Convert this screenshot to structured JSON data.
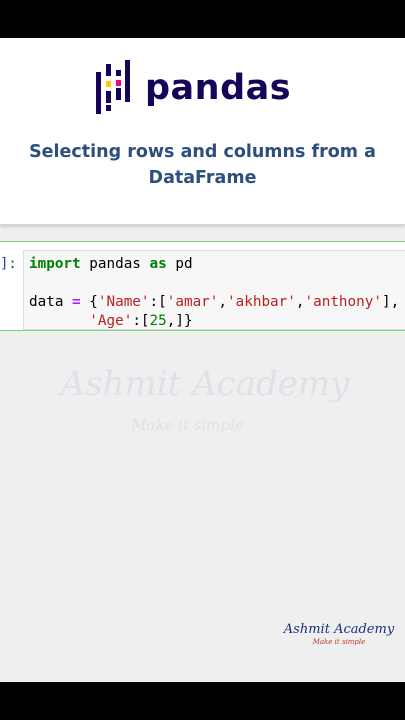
{
  "header": {
    "logo_text": "pandas",
    "subtitle": "Selecting rows and columns from a DataFrame"
  },
  "cell": {
    "prompt": "]:",
    "code": {
      "l1_kw1": "import",
      "l1_mod": " pandas ",
      "l1_kw2": "as",
      "l1_alias": " pd",
      "l3_var": "data ",
      "l3_op": "=",
      "l3_open": " {",
      "l3_key": "'Name'",
      "l3_colon": ":[",
      "l3_s1": "'amar'",
      "l3_c1": ",",
      "l3_s2": "'akhbar'",
      "l3_c2": ",",
      "l3_s3": "'anthony'",
      "l3_close": "],",
      "l4_indent": "       ",
      "l4_key": "'Age'",
      "l4_colon": ":[",
      "l4_num": "25",
      "l4_close": ",]}"
    }
  },
  "watermark": {
    "name": "Ashmit Academy",
    "tagline": "Make it simple"
  },
  "brand": {
    "name": "Ashmit Academy",
    "tagline": "Make it simple"
  },
  "colors": {
    "pandas_navy": "#150458",
    "pandas_yellow": "#ffca00",
    "pandas_pink": "#e70488",
    "subtitle": "#2d4f7e",
    "cell_border": "#7cd37c"
  }
}
